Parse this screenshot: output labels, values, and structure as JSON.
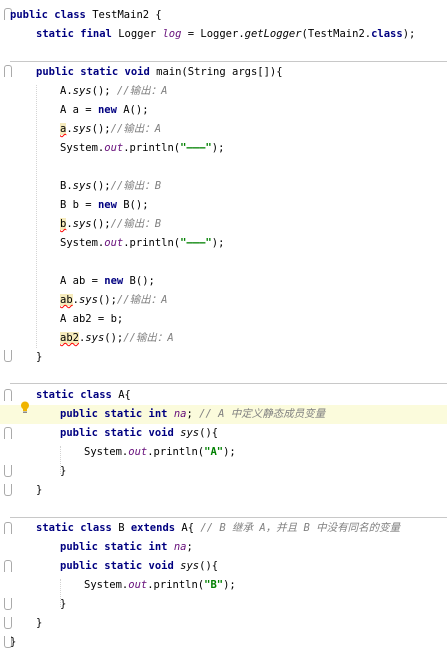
{
  "editor": {
    "lines": [
      "public class TestMain2 {",
      "static final Logger log = Logger.getLogger(TestMain2.class);",
      "public static void main(String args[]){",
      "A.sys(); //输出：A",
      "A a = new A();",
      "a.sys();//输出：A",
      "System.out.println(\"———\");",
      "B.sys();//输出：B",
      "B b = new B();",
      "b.sys();//输出：B",
      "System.out.println(\"———\");",
      "A ab = new B();",
      "ab.sys();//输出：A",
      "A ab2 = b;",
      "ab2.sys();//输出：A",
      "}",
      "static class A{",
      "public static int na; // A 中定义静态成员变量",
      "public static void sys(){",
      "System.out.println(\"A\");",
      "}",
      "}",
      "static class B extends A{ // B 继承 A，并且 B 中没有同名的变量",
      "public static int na;",
      "public static void sys(){",
      "System.out.println(\"B\");",
      "}",
      "}",
      "}"
    ]
  },
  "colors": {
    "keyword": "#000080",
    "field": "#660e7a",
    "comment": "#808080",
    "string": "#008000",
    "highlight_line": "#fbfbdc",
    "intention_bulb": "#f0b400"
  },
  "icons": {
    "intention": "lightbulb-icon",
    "fold": "fold-marker-icon"
  }
}
